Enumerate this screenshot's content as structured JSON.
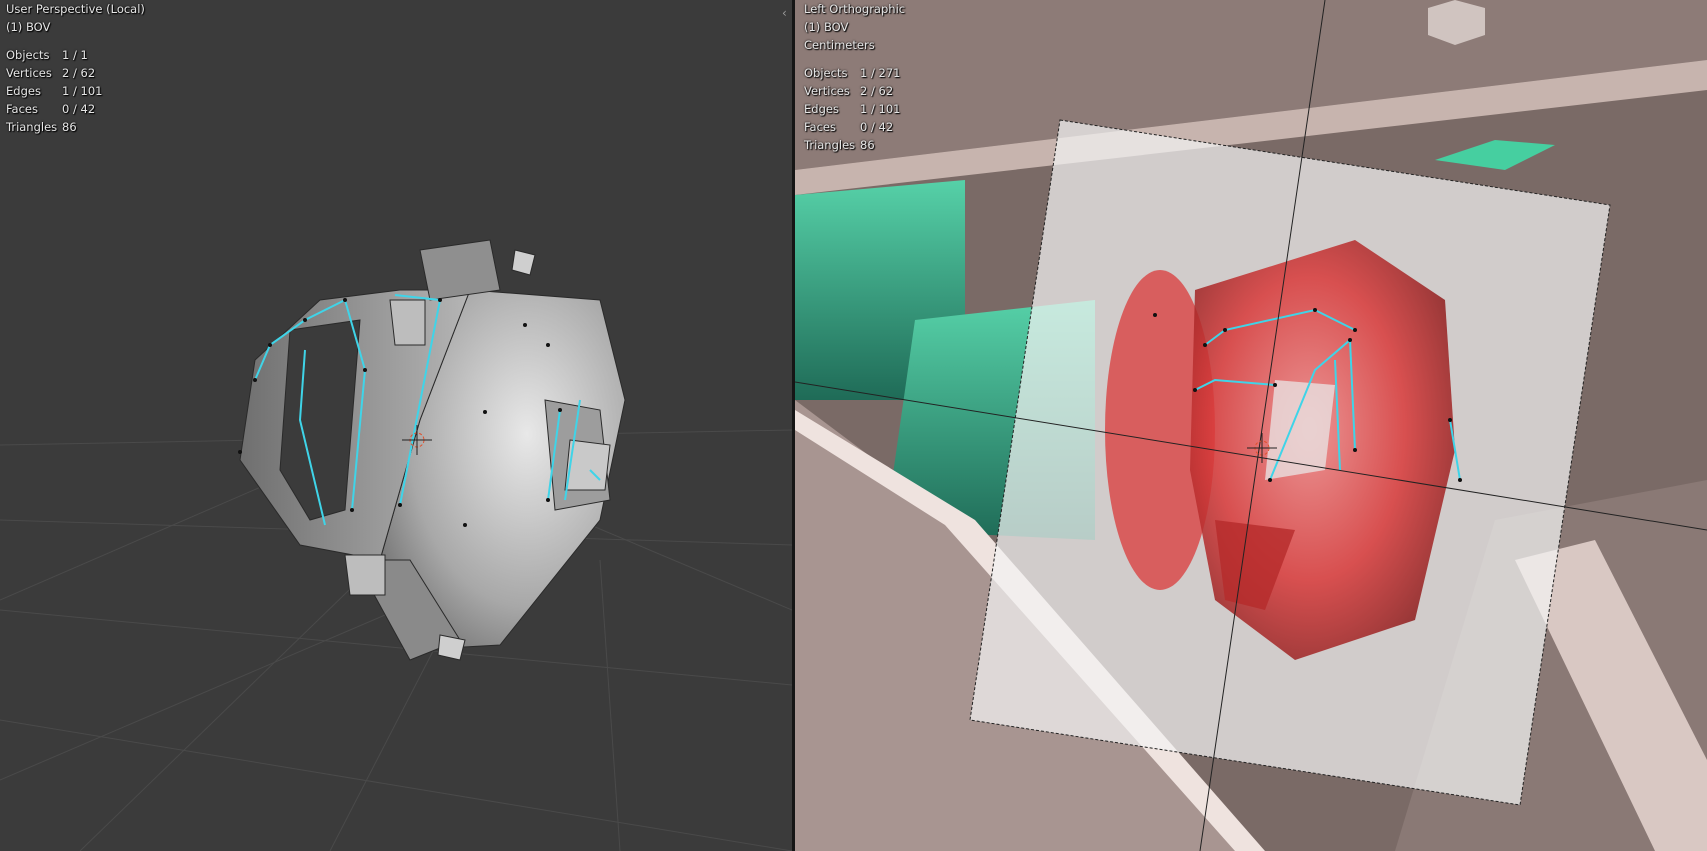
{
  "left_viewport": {
    "view_name": "User Perspective (Local)",
    "object_name": "(1) BOV",
    "stats": [
      {
        "label": "Objects",
        "value": "1 / 1"
      },
      {
        "label": "Vertices",
        "value": "2 / 62"
      },
      {
        "label": "Edges",
        "value": "1 / 101"
      },
      {
        "label": "Faces",
        "value": "0 / 42"
      },
      {
        "label": "Triangles",
        "value": "86"
      }
    ]
  },
  "right_viewport": {
    "view_name": "Left Orthographic",
    "object_name": "(1) BOV",
    "units": "Centimeters",
    "stats": [
      {
        "label": "Objects",
        "value": "1 / 271"
      },
      {
        "label": "Vertices",
        "value": "2 / 62"
      },
      {
        "label": "Edges",
        "value": "1 / 101"
      },
      {
        "label": "Faces",
        "value": "0 / 42"
      },
      {
        "label": "Triangles",
        "value": "86"
      }
    ]
  },
  "colors": {
    "left_background": "#3b3b3b",
    "right_background": "#7a6a66",
    "selected_edge": "#3fd4e8",
    "mesh_gray": "#9a9a9a",
    "reference_red": "#d93a3a",
    "teal_part": "#3fbf96"
  }
}
